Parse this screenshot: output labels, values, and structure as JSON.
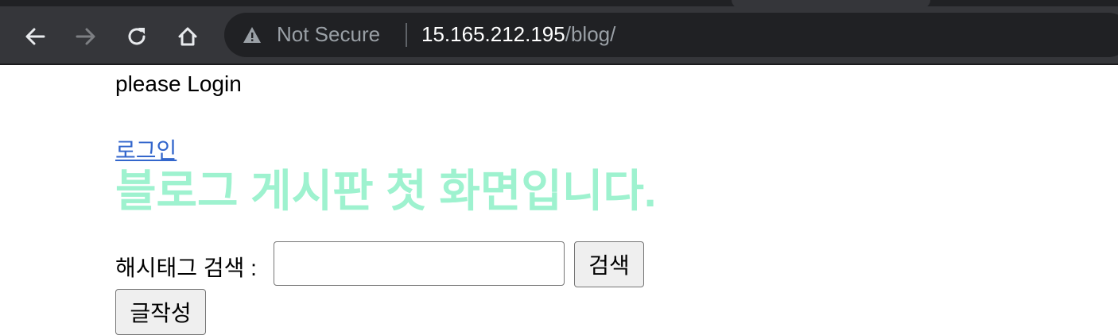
{
  "browser": {
    "security_label": "Not Secure",
    "url_host": "15.165.212.195",
    "url_path": "/blog/",
    "icons": {
      "back": "back-arrow-icon",
      "forward": "forward-arrow-icon",
      "reload": "reload-icon",
      "home": "home-icon",
      "warning": "warning-triangle-icon"
    }
  },
  "page": {
    "login_message": "please Login",
    "login_link": "로그인",
    "title": "블로그 게시판 첫 화면입니다.",
    "title_color": "#9ef2cf",
    "link_color": "#3366cc",
    "search": {
      "label": "해시태그 검색 :",
      "value": "",
      "button_label": "검색"
    },
    "write_button_label": "글작성"
  }
}
